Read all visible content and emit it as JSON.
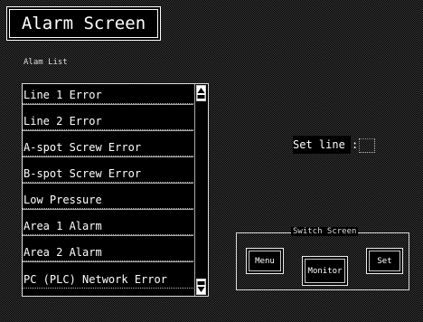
{
  "screen": {
    "title": "Alarm Screen"
  },
  "alarm_list": {
    "label": "Alam List",
    "items": [
      {
        "label": "Line 1 Error"
      },
      {
        "label": "Line 2 Error"
      },
      {
        "label": "A-spot Screw Error"
      },
      {
        "label": "B-spot Screw Error"
      },
      {
        "label": "Low Pressure"
      },
      {
        "label": "Area 1 Alarm"
      },
      {
        "label": "Area 2 Alarm"
      },
      {
        "label": "PC (PLC) Network Error"
      }
    ],
    "scroll_up_icon": "triangle-up-icon",
    "scroll_down_icon": "triangle-down-icon"
  },
  "set_line": {
    "label": "Set line :",
    "value": ""
  },
  "switch_screen": {
    "label": "Switch Screen",
    "buttons": [
      {
        "label": "Menu"
      },
      {
        "label": "Monitor"
      },
      {
        "label": "Set"
      }
    ]
  },
  "colors": {
    "background": "#000000",
    "pattern": "#3d3d3d",
    "foreground": "#ffffff"
  }
}
